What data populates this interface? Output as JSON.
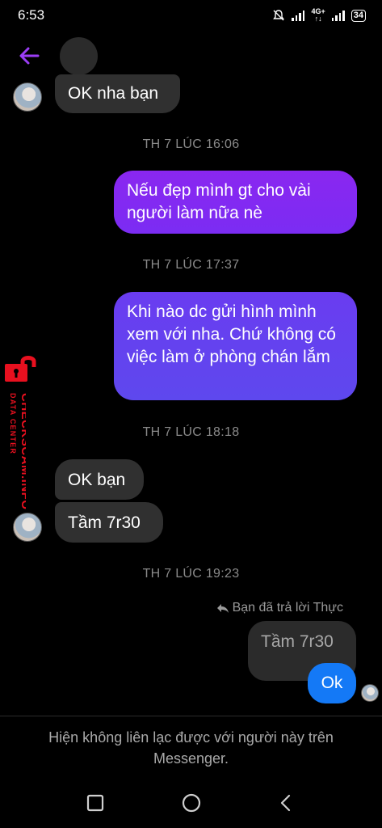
{
  "status_bar": {
    "time": "6:53",
    "network": "4G+",
    "battery": "34"
  },
  "messages": [
    {
      "id": "m1",
      "direction": "incoming",
      "text": "OK nha bạn"
    },
    {
      "id": "t1",
      "timestamp": "TH 7 LÚC 16:06"
    },
    {
      "id": "m2",
      "direction": "outgoing",
      "text": "Nếu đẹp mình gt cho vài người làm nữa nè"
    },
    {
      "id": "t2",
      "timestamp": "TH 7 LÚC 17:37"
    },
    {
      "id": "m3",
      "direction": "outgoing",
      "text": "Khi nào dc gửi hình mình xem với nha. Chứ không có việc làm ở phòng chán lắm"
    },
    {
      "id": "t3",
      "timestamp": "TH 7 LÚC 18:18"
    },
    {
      "id": "m4",
      "direction": "incoming",
      "text": "OK bạn"
    },
    {
      "id": "m5",
      "direction": "incoming",
      "text": "Tầm 7r30"
    },
    {
      "id": "t4",
      "timestamp": "TH 7 LÚC 19:23"
    },
    {
      "id": "m6",
      "direction": "outgoing",
      "reply_to_label": "Bạn đã trả lời Thực",
      "quoted_text": "Tầm 7r30",
      "text": "Ok"
    }
  ],
  "watermark": {
    "line1": "DATA CENTER",
    "line2": "CHECKSCAM.INFO"
  },
  "footer": {
    "notice": "Hiện không liên lạc được với người này trên Messenger."
  },
  "colors": {
    "outgoing_bubble_top": "#8a27f0",
    "outgoing_bubble_bottom": "#5e48ee",
    "reply_bubble": "#1479f6",
    "incoming_bubble": "#303030",
    "back_arrow": "#9b3df5",
    "watermark": "#e8101f"
  },
  "icons": {
    "back": "arrow-left-icon",
    "reply": "reply-arrow-icon",
    "nav_recent": "square-icon",
    "nav_home": "circle-icon",
    "nav_back": "chevron-left-icon"
  }
}
